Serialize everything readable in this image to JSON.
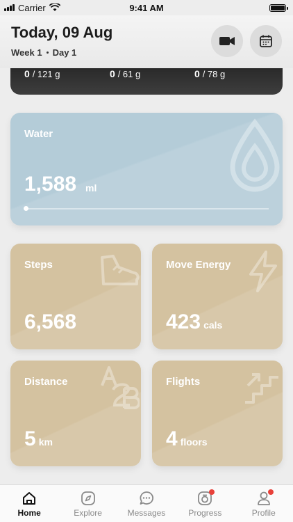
{
  "status": {
    "carrier": "Carrier",
    "time": "9:41 AM"
  },
  "header": {
    "title": "Today, 09 Aug",
    "week": "Week 1",
    "day": "Day 1"
  },
  "nutrition": {
    "items": [
      {
        "value": "0",
        "total": "/ 121 g"
      },
      {
        "value": "0",
        "total": "/ 61 g"
      },
      {
        "value": "0",
        "total": "/ 78 g"
      }
    ]
  },
  "water": {
    "title": "Water",
    "value": "1,588",
    "unit": "ml",
    "progress": 0.0
  },
  "steps": {
    "title": "Steps",
    "value": "6,568"
  },
  "move": {
    "title": "Move Energy",
    "value": "423",
    "unit": "cals"
  },
  "distance": {
    "title": "Distance",
    "value": "5",
    "unit": "km",
    "icon": "A2B-icon"
  },
  "flights": {
    "title": "Flights",
    "value": "4",
    "unit": "floors"
  },
  "tabs": [
    {
      "label": "Home",
      "icon": "home-icon",
      "active": true
    },
    {
      "label": "Explore",
      "icon": "compass-icon"
    },
    {
      "label": "Messages",
      "icon": "chat-icon"
    },
    {
      "label": "Progress",
      "icon": "progress-icon",
      "badge": true
    },
    {
      "label": "Profile",
      "icon": "user-icon",
      "badge": true
    }
  ],
  "colors": {
    "water_card": "#b4ccd8",
    "activity_card": "#d4c2a0",
    "badge": "#e8413a",
    "nutrition_card": "#2f2f2f"
  }
}
